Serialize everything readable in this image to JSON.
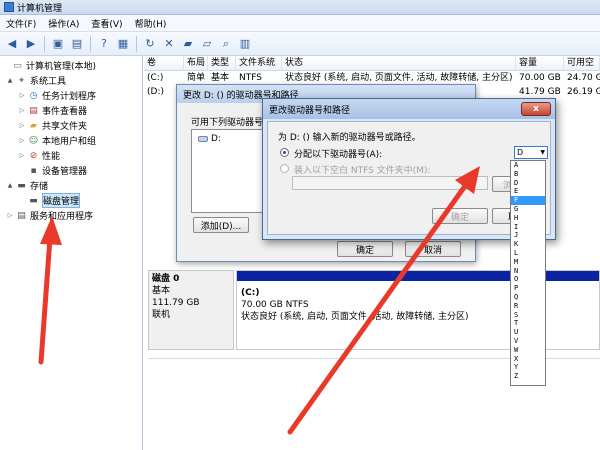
{
  "window": {
    "title": "计算机管理"
  },
  "menu": [
    "文件(F)",
    "操作(A)",
    "查看(V)",
    "帮助(H)"
  ],
  "toolbar": [
    "back-icon",
    "forward-icon",
    "up-icon",
    "console-tree-icon",
    "help-icon",
    "properties-icon",
    "refresh-icon",
    "delete-icon",
    "folder-icon",
    "open-icon",
    "zoom-icon",
    "settings-icon"
  ],
  "tree": [
    {
      "label": "计算机管理(本地)",
      "indent": 0,
      "expander": "",
      "icon": "computer-icon"
    },
    {
      "label": "系统工具",
      "indent": 1,
      "expander": "▲",
      "icon": "tools-icon"
    },
    {
      "label": "任务计划程序",
      "indent": 2,
      "expander": "▷",
      "icon": "clock-icon"
    },
    {
      "label": "事件查看器",
      "indent": 2,
      "expander": "▷",
      "icon": "event-icon"
    },
    {
      "label": "共享文件夹",
      "indent": 2,
      "expander": "▷",
      "icon": "folder-icon"
    },
    {
      "label": "本地用户和组",
      "indent": 2,
      "expander": "▷",
      "icon": "users-icon"
    },
    {
      "label": "性能",
      "indent": 2,
      "expander": "▷",
      "icon": "performance-icon"
    },
    {
      "label": "设备管理器",
      "indent": 2,
      "expander": "",
      "icon": "device-icon"
    },
    {
      "label": "存储",
      "indent": 1,
      "expander": "▲",
      "icon": "storage-icon"
    },
    {
      "label": "磁盘管理",
      "indent": 2,
      "expander": "",
      "icon": "disk-icon",
      "selected": true
    },
    {
      "label": "服务和应用程序",
      "indent": 1,
      "expander": "▷",
      "icon": "services-icon"
    }
  ],
  "volume_table": {
    "headers": [
      "卷",
      "布局",
      "类型",
      "文件系统",
      "状态",
      "容量",
      "可用空"
    ],
    "rows": [
      [
        "(C:)",
        "简单",
        "基本",
        "NTFS",
        "状态良好 (系统, 启动, 页面文件, 活动, 故障转储, 主分区)",
        "70.00 GB",
        "24.70 G"
      ],
      [
        "(D:)",
        "",
        "",
        "",
        "",
        "41.79 GB",
        "26.19 G"
      ]
    ]
  },
  "disk": {
    "name": "磁盘 0",
    "type": "基本",
    "size": "111.79 GB",
    "status": "联机",
    "partition": {
      "label": "(C:)",
      "size_fs": "70.00 GB NTFS",
      "status": "状态良好 (系统, 启动, 页面文件, 活动, 故障转储, 主分区)"
    }
  },
  "dialog_back": {
    "title": "更改 D: () 的驱动器号和路径",
    "list_label": "可用下列驱动器号和路径",
    "list_item": "D:",
    "add_label": "添加(D)...",
    "ok_label": "确定",
    "cancel_label": "取消"
  },
  "dialog_front": {
    "title": "更改驱动器号和路径",
    "instruction": "为 D: () 输入新的驱动器号或路径。",
    "radio_assign": "分配以下驱动器号(A):",
    "radio_mount": "装入以下空白 NTFS 文件夹中(M):",
    "browse_label": "浏览",
    "ok_label": "确定",
    "cancel_label": "取消",
    "selected_letter": "D",
    "close_label": "x"
  },
  "dropdown": {
    "items": [
      "A",
      "B",
      "D",
      "E",
      "F",
      "G",
      "H",
      "I",
      "J",
      "K",
      "L",
      "M",
      "N",
      "O",
      "P",
      "Q",
      "R",
      "S",
      "T",
      "U",
      "V",
      "W",
      "X",
      "Y",
      "Z"
    ],
    "highlighted": "F"
  }
}
